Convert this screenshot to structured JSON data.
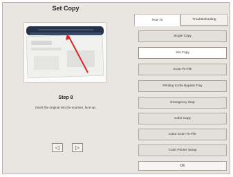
{
  "title": "Set Copy",
  "step": {
    "title": "Step 8",
    "instruction": "Insert the original into the scanner, face up."
  },
  "tabs": [
    {
      "label": "How To",
      "active": true
    },
    {
      "label": "Troubleshooting",
      "active": false
    }
  ],
  "options": [
    {
      "label": "Single Copy"
    },
    {
      "label": "Set Copy",
      "selected": true
    },
    {
      "label": "Scan-To-File"
    },
    {
      "label": "Printing to the Bypass Tray"
    },
    {
      "label": "Emergency Stop"
    },
    {
      "label": "Color Copy"
    },
    {
      "label": "Color Scan-To-File"
    },
    {
      "label": "Color Printer Setup"
    }
  ],
  "ok_label": "OK",
  "nav": {
    "prev_glyph": "◁",
    "next_glyph": "▷"
  },
  "colors": {
    "panel": "#e9e6e2",
    "selected": "#ffffff",
    "arrow": "#d92626"
  }
}
